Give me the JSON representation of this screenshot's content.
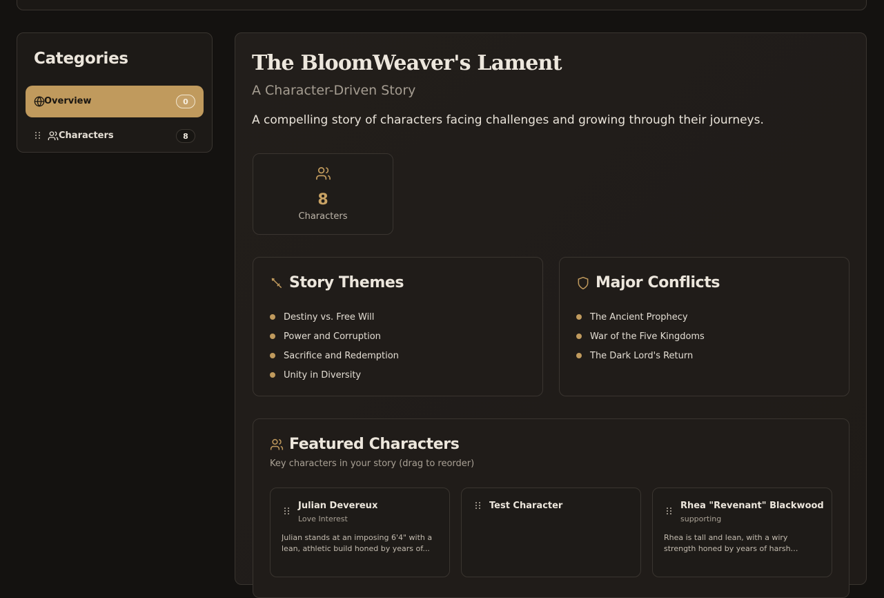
{
  "sidebar": {
    "title": "Categories",
    "items": [
      {
        "label": "Overview",
        "count": "0",
        "icon": "globe-icon",
        "active": true
      },
      {
        "label": "Characters",
        "count": "8",
        "icon": "users-icon",
        "active": false
      }
    ]
  },
  "story": {
    "title": "The BloomWeaver's Lament",
    "subtitle": "A Character-Driven Story",
    "description": "A compelling story of characters facing challenges and growing through their journeys."
  },
  "stats": {
    "characters_count": "8",
    "characters_label": "Characters"
  },
  "themes": {
    "title": "Story Themes",
    "items": [
      "Destiny vs. Free Will",
      "Power and Corruption",
      "Sacrifice and Redemption",
      "Unity in Diversity"
    ]
  },
  "conflicts": {
    "title": "Major Conflicts",
    "items": [
      "The Ancient Prophecy",
      "War of the Five Kingdoms",
      "The Dark Lord's Return"
    ]
  },
  "featured": {
    "title": "Featured Characters",
    "subtitle": "Key characters in your story (drag to reorder)",
    "characters": [
      {
        "name": "Julian Devereux",
        "role": "Love Interest",
        "description": "Julian stands at an imposing 6'4\" with a lean, athletic build honed by years of..."
      },
      {
        "name": "Test Character",
        "role": "",
        "description": ""
      },
      {
        "name": "Rhea \"Revenant\" Blackwood",
        "role": "supporting",
        "description": "Rhea is tall and lean, with a wiry strength honed by years of harsh training. Her fac..."
      }
    ]
  },
  "colors": {
    "accent": "#c09a5d",
    "background": "#141210",
    "panel": "#201c19"
  }
}
